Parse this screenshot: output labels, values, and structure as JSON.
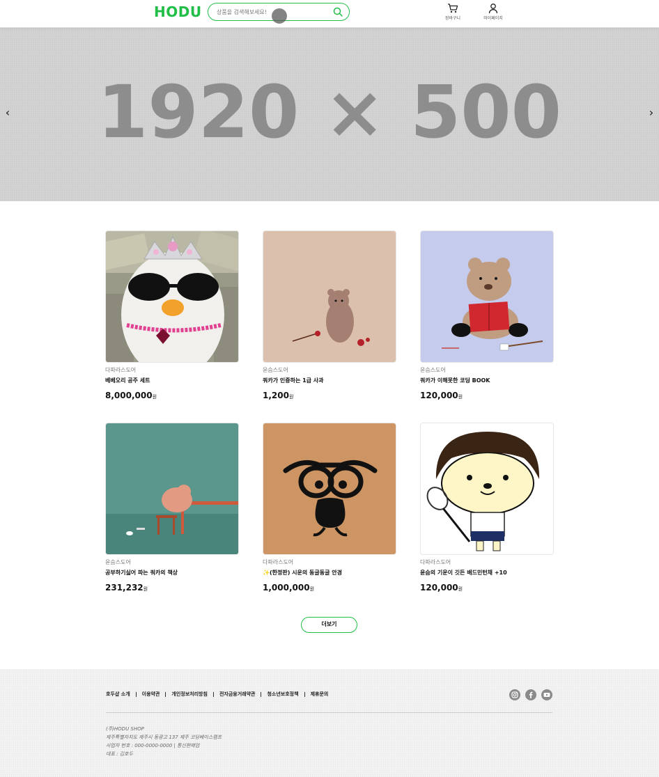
{
  "header": {
    "logo": "HODU",
    "search_placeholder": "상품을 검색해보세요!",
    "cart_label": "장바구니",
    "mypage_label": "마이페이지"
  },
  "banner": {
    "text": "1920 × 500",
    "prev": "‹",
    "next": "›"
  },
  "products": [
    {
      "store": "다파라스도어",
      "name": "베베오리 공주 세트",
      "price": "8,000,000",
      "unit": "원",
      "image": "duck-with-sunglasses-and-crown"
    },
    {
      "store": "윤슴스도어",
      "name": "쿼카가 인증하는 1급 사과",
      "price": "1,200",
      "unit": "원",
      "image": "quokka-with-apples"
    },
    {
      "store": "윤슴스도어",
      "name": "쿼카가 이해못한 코딩 BOOK",
      "price": "120,000",
      "unit": "원",
      "image": "bear-reading-book"
    },
    {
      "store": "윤슴스도어",
      "name": "공부하기싫어 파는 쿼카의 책상",
      "price": "231,232",
      "unit": "원",
      "image": "quokka-at-desk"
    },
    {
      "store": "다파라스도어",
      "name": "✨(한정판) 시운의 동글동글 안경",
      "price": "1,000,000",
      "unit": "원",
      "image": "creature-with-glasses"
    },
    {
      "store": "다파라스도어",
      "name": "윤슴의 기운이 깃든 배드민턴채 +10",
      "price": "120,000",
      "unit": "원",
      "image": "cartoon-badminton-player"
    }
  ],
  "more_button": "더보기",
  "footer": {
    "links": [
      "호두샵 소개",
      "이용약관",
      "개인정보처리방침",
      "전자금융거래약관",
      "청소년보호정책",
      "제휴문의"
    ],
    "social": [
      "instagram-icon",
      "facebook-icon",
      "youtube-icon"
    ],
    "info": [
      "(주)HODU SHOP",
      "제주특별자치도 제주시 동광고 137 제주 코딩베이스캠프",
      "사업자 번호 : 000-0000-0000 | 통신판매업",
      "대표 : 김호두"
    ]
  },
  "colors": {
    "brand": "#21bf48",
    "banner_bg": "#cfcfcf",
    "banner_text": "#8d8d8d"
  }
}
